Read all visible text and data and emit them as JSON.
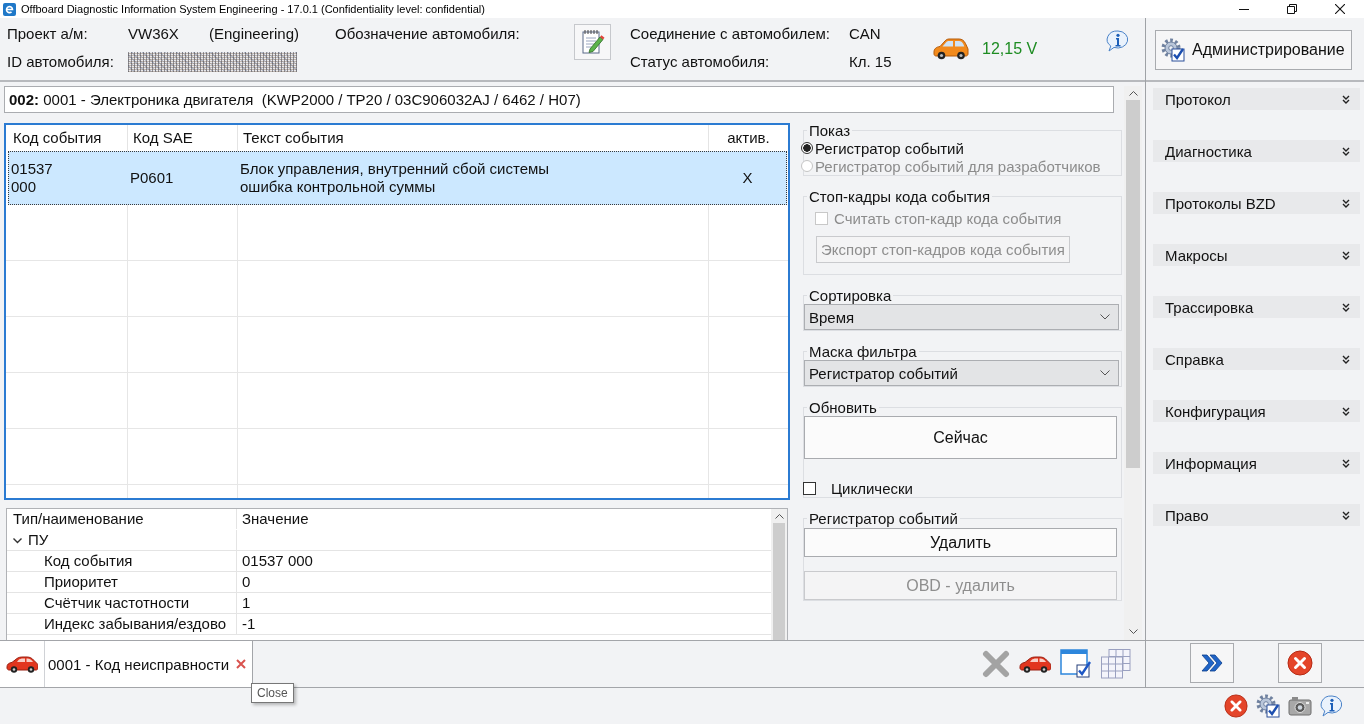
{
  "window": {
    "title": "Offboard Diagnostic Information System Engineering - 17.0.1 (Confidentiality level: confidential)"
  },
  "header": {
    "project_label": "Проект а/м:",
    "project": "VW36X",
    "project_mode": "(Engineering)",
    "designation_label": "Обозначение автомобиля:",
    "vehicle_id_label": "ID автомобиля:",
    "connection_label": "Соединение с автомобилем:",
    "connection": "CAN",
    "status_label": "Статус автомобиля:",
    "status": "Кл. 15",
    "voltage": "12,15 V"
  },
  "control_unit": {
    "title": "**002:** 0001 - Электроника двигателя  (KWP2000 / TP20 / 03C906032AJ / 6462 / H07)"
  },
  "event_table": {
    "columns": [
      "Код события",
      "Код SAE",
      "Текст события",
      "актив."
    ],
    "rows": [
      {
        "event_code": "01537\n000",
        "sae_code": "P0601",
        "text": "Блок управления, внутренний сбой системы\nошибка контрольной суммы",
        "active": "X",
        "selected": true
      }
    ]
  },
  "controls": {
    "display": {
      "title": "Показ",
      "options": [
        {
          "label": "Регистратор событий",
          "selected": true,
          "disabled": false
        },
        {
          "label": "Регистратор событий для разработчиков",
          "selected": false,
          "disabled": true
        }
      ]
    },
    "freeze_frames": {
      "title": "Стоп-кадры кода события",
      "read": {
        "label": "Считать стоп-кадр кода события",
        "checked": false,
        "disabled": true
      },
      "export": {
        "label": "Экспорт стоп-кадров кода события",
        "disabled": true
      }
    },
    "sorting": {
      "title": "Сортировка",
      "value": "Время"
    },
    "filter_mask": {
      "title": "Маска фильтра",
      "value": "Регистратор событий"
    },
    "refresh": {
      "title": "Обновить",
      "button": "Сейчас",
      "cyclic": {
        "label": "Циклически",
        "checked": false
      }
    },
    "event_memory": {
      "title": "Регистратор событий",
      "buttons": [
        {
          "label": "Удалить",
          "disabled": false
        },
        {
          "label": "OBD - удалить",
          "disabled": true
        }
      ]
    }
  },
  "properties": {
    "columns": [
      "Тип/наименование",
      "Значение"
    ],
    "groups": [
      {
        "name": "ПУ",
        "expanded": true,
        "children": [
          {
            "name": "Код события",
            "value": "01537 000"
          },
          {
            "name": "Приоритет",
            "value": "0"
          },
          {
            "name": "Счётчик частотности",
            "value": "1"
          },
          {
            "name": "Индекс забывания/ездово",
            "value": "-1"
          }
        ]
      }
    ]
  },
  "tabs": [
    {
      "label": "0001 - Код неисправности",
      "selected": true
    }
  ],
  "tooltip": "Close",
  "sidebar": {
    "admin_button": "Администрирование",
    "items": [
      {
        "label": "Протокол",
        "expanded": false
      },
      {
        "label": "Диагностика",
        "expanded": false
      },
      {
        "label": "Протоколы BZD",
        "expanded": false
      },
      {
        "label": "Макросы",
        "expanded": false
      },
      {
        "label": "Трассировка",
        "expanded": false
      },
      {
        "label": "Справка",
        "expanded": false
      },
      {
        "label": "Конфигурация",
        "expanded": false
      },
      {
        "label": "Информация",
        "expanded": false
      },
      {
        "label": "Право",
        "expanded": false
      }
    ]
  }
}
